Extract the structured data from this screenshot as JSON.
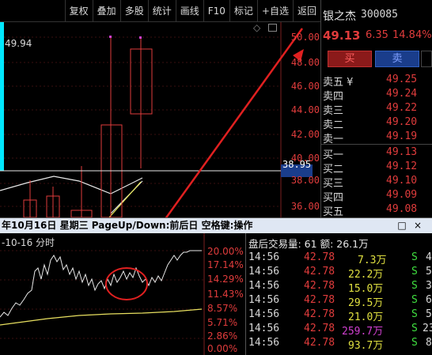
{
  "toolbar": {
    "buttons": [
      "复权",
      "叠加",
      "多股",
      "统计",
      "画线",
      "F10",
      "标记",
      "+自选",
      "返回"
    ]
  },
  "chart": {
    "price_axis": [
      "50.00",
      "48.00",
      "46.00",
      "44.00",
      "42.00",
      "40.00",
      "38.00",
      "36.00"
    ],
    "current_line_label": "38.95",
    "left_value": "49.94",
    "diamond": "◇"
  },
  "stock": {
    "name": "银之杰",
    "code": "300085",
    "price": "49.13",
    "change": "6.35",
    "change_pct": "14.84%",
    "buy_label": "买",
    "sell_label": "卖"
  },
  "sell_orders": [
    {
      "label": "卖五 ¥",
      "price": "49.25"
    },
    {
      "label": "卖四",
      "price": "49.24"
    },
    {
      "label": "卖三",
      "price": "49.22"
    },
    {
      "label": "卖二",
      "price": "49.20"
    },
    {
      "label": "卖一",
      "price": "49.19"
    }
  ],
  "buy_orders": [
    {
      "label": "买一",
      "price": "49.13"
    },
    {
      "label": "买二",
      "price": "49.12"
    },
    {
      "label": "买三",
      "price": "49.10"
    },
    {
      "label": "买四",
      "price": "49.09"
    },
    {
      "label": "买五",
      "price": "49.08"
    }
  ],
  "popup": {
    "title": "年10月16日 星期三 PageUp/Down:前后日 空格键:操作",
    "date_label": "-10-16 分时",
    "close_icons": [
      "□",
      "×"
    ],
    "pct_axis": [
      "20.00%",
      "17.14%",
      "14.29%",
      "11.43%",
      "8.57%",
      "5.71%",
      "2.86%",
      "0.00%"
    ],
    "trade_header": "盘后交易量: 61  额: 26.1万",
    "trades": [
      {
        "time": "14:56",
        "price": "42.78",
        "amount": "7.3万",
        "flag": "S",
        "count": "4"
      },
      {
        "time": "14:56",
        "price": "42.78",
        "amount": "22.2万",
        "flag": "S",
        "count": "5"
      },
      {
        "time": "14:56",
        "price": "42.78",
        "amount": "15.0万",
        "flag": "S",
        "count": "3"
      },
      {
        "time": "14:56",
        "price": "42.78",
        "amount": "29.5万",
        "flag": "S",
        "count": "6"
      },
      {
        "time": "14:56",
        "price": "42.78",
        "amount": "21.0万",
        "flag": "S",
        "count": "5"
      },
      {
        "time": "14:56",
        "price": "42.78",
        "amount": "259.7万",
        "flag": "S",
        "count": "23"
      },
      {
        "time": "14:56",
        "price": "42.78",
        "amount": "93.7万",
        "flag": "S",
        "count": "8"
      }
    ]
  },
  "colors": {
    "up": "#e03c3c",
    "down": "#00c0c0",
    "buy_bg": "#8b1a1a",
    "sell_bg": "#1a3d8b",
    "annotation": "#e02020"
  }
}
